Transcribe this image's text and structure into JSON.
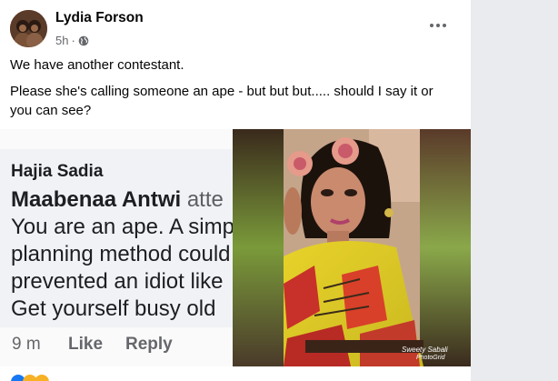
{
  "post": {
    "author": "Lydia Forson",
    "time": "5h",
    "separator": "·",
    "line1": "We have another contestant.",
    "line2": "Please she's calling someone an ape - but but but..... should I say it or you can see?"
  },
  "screenshot": {
    "commenter": "Hajia Sadia",
    "mention": "Maabenaa Antwi",
    "mention_suffix": "atte",
    "lines": [
      "You are an ape. A simp",
      "planning method could",
      "prevented an idiot like",
      "Get yourself busy old "
    ],
    "time": "9 m",
    "like": "Like",
    "reply": "Reply",
    "watermark": "Sweety Sabali",
    "watermark2": "PhotoGrid"
  },
  "icons": {
    "globe": "globe-icon",
    "more": "more-options-icon"
  }
}
